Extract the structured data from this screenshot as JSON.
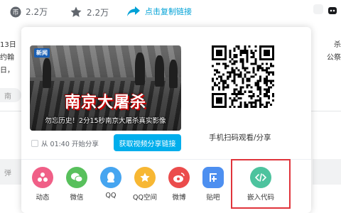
{
  "topbar": {
    "coin_count": "2.2万",
    "favorite_count": "2.2万",
    "share_label": "点击复制链接"
  },
  "background": {
    "left_lines": [
      "13日",
      "约翰",
      "日，"
    ],
    "right_lines": [
      "杀",
      "公祭",
      ""
    ],
    "left_pill": "南",
    "left_input": "弹"
  },
  "popup": {
    "video_thumb": {
      "logo": "新闻",
      "title": "南京大屠杀",
      "subtitle": "勿忘历史！2分15秒南京大屠杀真实影像"
    },
    "qr_caption": "手机扫码观看/分享",
    "start_share_label": "从 01:40 开始分享",
    "get_link_button": "获取视频分享链接",
    "share_targets": [
      {
        "label": "动态",
        "icon": "dynamic-icon",
        "color": "#f05f87"
      },
      {
        "label": "微信",
        "icon": "wechat-icon",
        "color": "#58c05c"
      },
      {
        "label": "QQ",
        "icon": "qq-icon",
        "color": "#46a5f0"
      },
      {
        "label": "QQ空间",
        "icon": "qzone-icon",
        "color": "#f7b733"
      },
      {
        "label": "微博",
        "icon": "weibo-icon",
        "color": "#eb4c4c"
      },
      {
        "label": "贴吧",
        "icon": "tieba-icon",
        "color": "#4d8ff0"
      },
      {
        "label": "嵌入代码",
        "icon": "embed-code-icon",
        "color": "#4dc39e"
      }
    ],
    "highlight_color": "#e0343b",
    "accent_color": "#00aeec"
  }
}
